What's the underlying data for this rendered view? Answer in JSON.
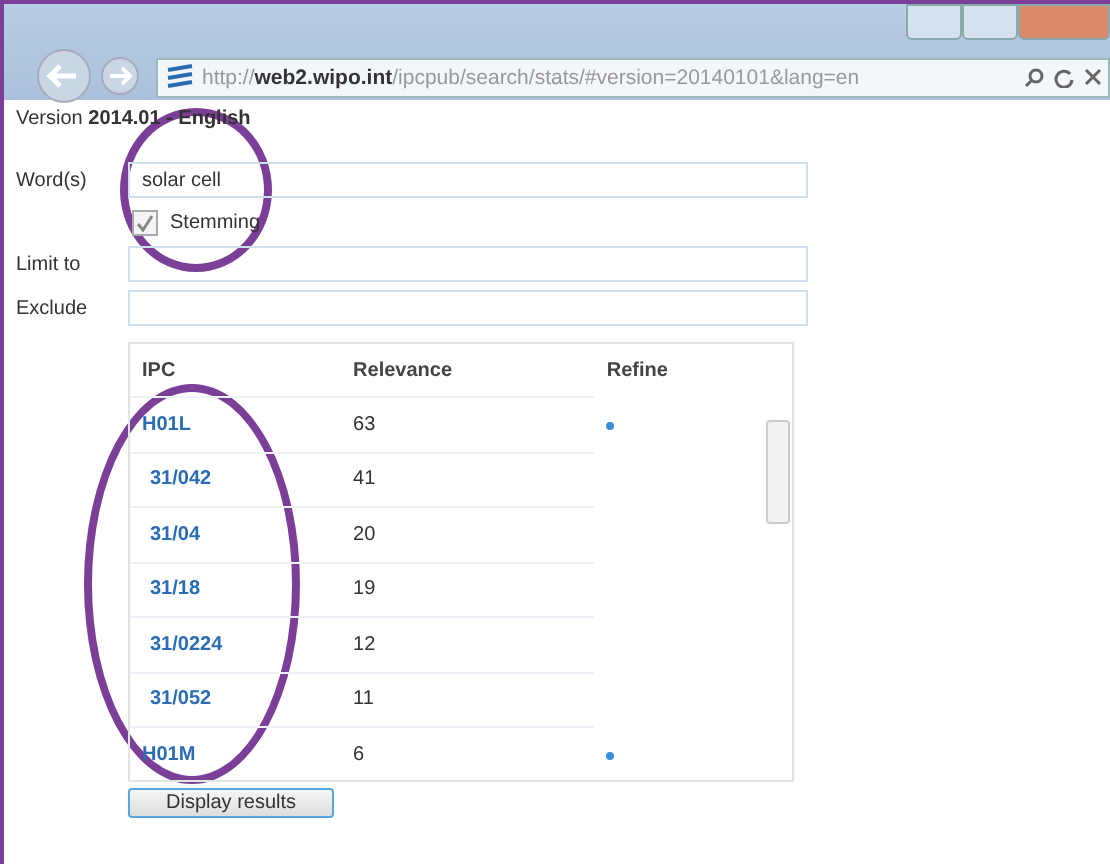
{
  "browser": {
    "url": "http://**web2.wipo.int**/ipcpub/search/stats/#version=20140101&lang=en"
  },
  "version_line": "Version **2014.01 - English**",
  "form": {
    "words_label": "Word(s)",
    "words_value": "solar cell",
    "stemming": {
      "label": "Stemming",
      "checked": true
    },
    "limit_label": "Limit to",
    "exclude_label": "Exclude"
  },
  "table": {
    "columns": [
      "IPC",
      "Relevance",
      "Refine"
    ],
    "rows": [
      {
        "kind": "class",
        "code": "H01L",
        "relevance": "63"
      },
      {
        "kind": "group",
        "code": "31/042",
        "relevance": "41"
      },
      {
        "kind": "group",
        "code": "31/04",
        "relevance": "20"
      },
      {
        "kind": "group",
        "code": "31/18",
        "relevance": "19"
      },
      {
        "kind": "group",
        "code": "31/0224",
        "relevance": "12"
      },
      {
        "kind": "group",
        "code": "31/052",
        "relevance": "11"
      },
      {
        "kind": "class",
        "code": "H01M",
        "relevance": "6"
      }
    ]
  },
  "button": "Display results"
}
